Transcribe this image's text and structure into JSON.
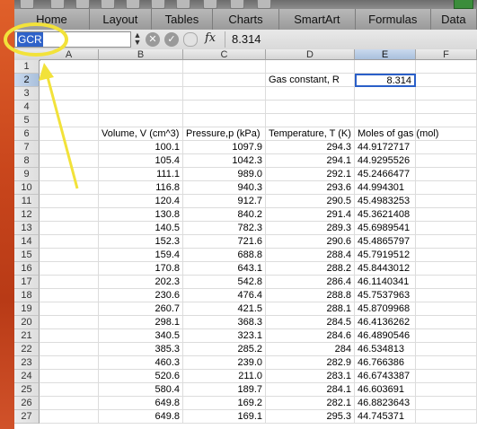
{
  "ribbon": {
    "tabs": [
      {
        "label": "Home",
        "width": 84
      },
      {
        "label": "Layout",
        "width": 69
      },
      {
        "label": "Tables",
        "width": 68
      },
      {
        "label": "Charts",
        "width": 74
      },
      {
        "label": "SmartArt",
        "width": 85
      },
      {
        "label": "Formulas",
        "width": 84
      },
      {
        "label": "Data",
        "width": 51
      }
    ]
  },
  "formula_bar": {
    "name_box": "GCR",
    "fx_label": "fx",
    "content": "8.314"
  },
  "sheet": {
    "columns": [
      "A",
      "B",
      "C",
      "D",
      "E",
      "F"
    ],
    "selected_column": "E",
    "selected_row": 2,
    "rows": [
      1,
      2,
      3,
      4,
      5,
      6,
      7,
      8,
      9,
      10,
      11,
      12,
      13,
      14,
      15,
      16,
      17,
      18,
      19,
      20,
      21,
      22,
      23,
      24,
      25,
      26,
      27
    ],
    "gas_label": "Gas constant, R",
    "gas_value": "8.314",
    "headers": {
      "volume": "Volume, V (cm^3)",
      "pressure": "Pressure,p (kPa)",
      "temperature": "Temperature, T (K)",
      "moles": "Moles of gas (mol)"
    },
    "data": [
      [
        "100.1",
        "1097.9",
        "294.3",
        "44.9172717"
      ],
      [
        "105.4",
        "1042.3",
        "294.1",
        "44.9295526"
      ],
      [
        "111.1",
        "989.0",
        "292.1",
        "45.2466477"
      ],
      [
        "116.8",
        "940.3",
        "293.6",
        "44.994301"
      ],
      [
        "120.4",
        "912.7",
        "290.5",
        "45.4983253"
      ],
      [
        "130.8",
        "840.2",
        "291.4",
        "45.3621408"
      ],
      [
        "140.5",
        "782.3",
        "289.3",
        "45.6989541"
      ],
      [
        "152.3",
        "721.6",
        "290.6",
        "45.4865797"
      ],
      [
        "159.4",
        "688.8",
        "288.4",
        "45.7919512"
      ],
      [
        "170.8",
        "643.1",
        "288.2",
        "45.8443012"
      ],
      [
        "202.3",
        "542.8",
        "286.4",
        "46.1140341"
      ],
      [
        "230.6",
        "476.4",
        "288.8",
        "45.7537963"
      ],
      [
        "260.7",
        "421.5",
        "288.1",
        "45.8709968"
      ],
      [
        "298.1",
        "368.3",
        "284.5",
        "46.4136262"
      ],
      [
        "340.5",
        "323.1",
        "284.6",
        "46.4890546"
      ],
      [
        "385.3",
        "285.2",
        "284",
        "46.534813"
      ],
      [
        "460.3",
        "239.0",
        "282.9",
        "46.766386"
      ],
      [
        "520.6",
        "211.0",
        "283.1",
        "46.6743387"
      ],
      [
        "580.4",
        "189.7",
        "284.1",
        "46.603691"
      ],
      [
        "649.8",
        "169.2",
        "282.1",
        "46.8823643"
      ],
      [
        "649.8",
        "169.1",
        "295.3",
        "44.745371"
      ]
    ]
  }
}
